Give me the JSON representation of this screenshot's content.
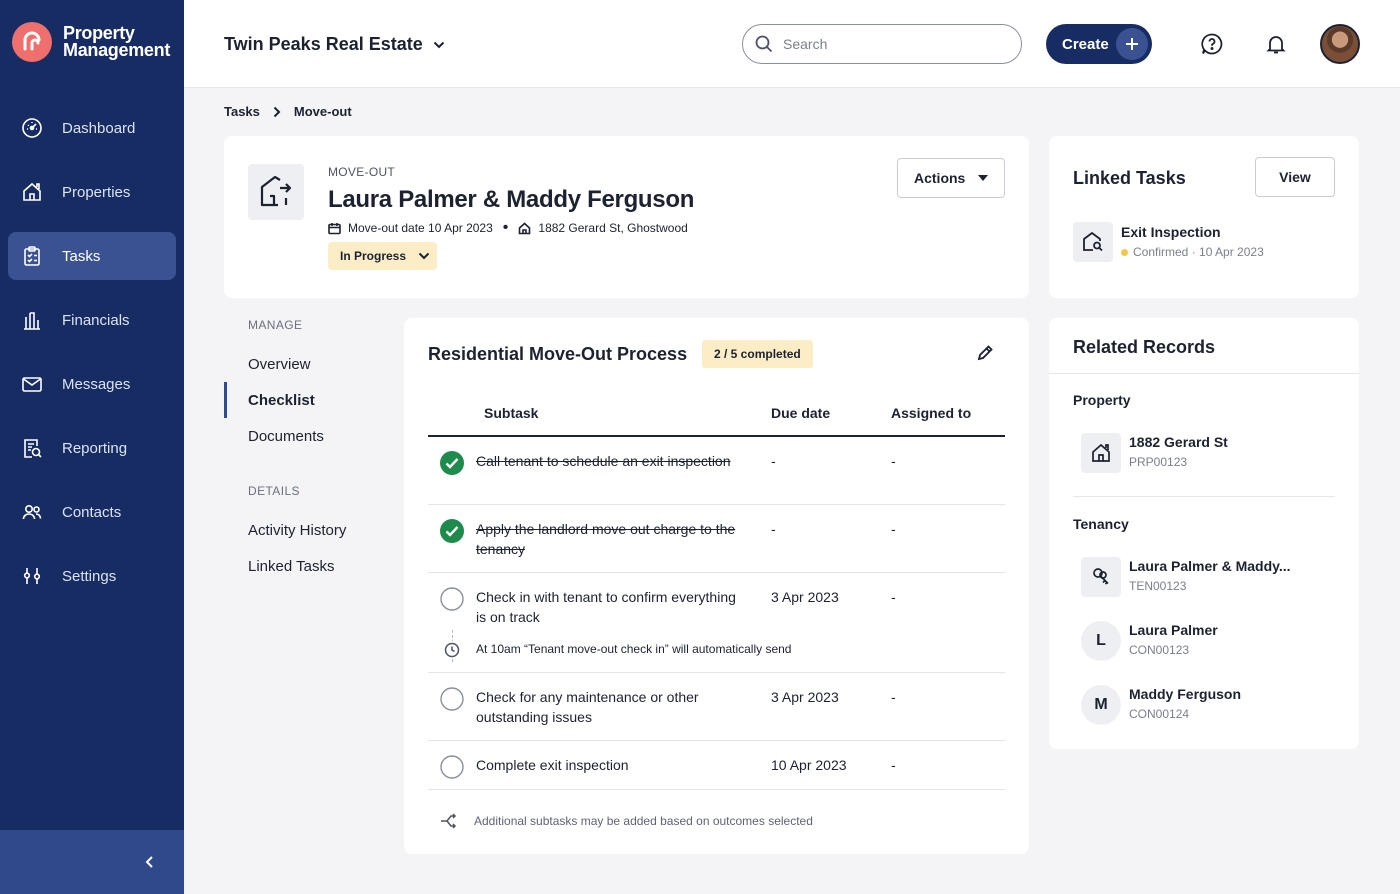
{
  "brand": {
    "line1": "Property",
    "line2": "Management"
  },
  "sidebar": {
    "items": [
      {
        "label": "Dashboard",
        "icon": "dashboard-icon",
        "active": false
      },
      {
        "label": "Properties",
        "icon": "house-icon",
        "active": false
      },
      {
        "label": "Tasks",
        "icon": "clipboard-icon",
        "active": true
      },
      {
        "label": "Financials",
        "icon": "bank-icon",
        "active": false
      },
      {
        "label": "Messages",
        "icon": "envelope-icon",
        "active": false
      },
      {
        "label": "Reporting",
        "icon": "report-icon",
        "active": false
      },
      {
        "label": "Contacts",
        "icon": "people-icon",
        "active": false
      },
      {
        "label": "Settings",
        "icon": "sliders-icon",
        "active": false
      }
    ]
  },
  "header": {
    "company": "Twin Peaks Real Estate",
    "search_placeholder": "Search",
    "create_label": "Create"
  },
  "breadcrumb": {
    "parent": "Tasks",
    "current": "Move-out"
  },
  "task": {
    "kicker": "MOVE-OUT",
    "title": "Laura Palmer & Maddy Ferguson",
    "moveout_date": "Move-out date 10 Apr 2023",
    "address": "1882 Gerard St, Ghostwood",
    "status": "In Progress",
    "actions_label": "Actions"
  },
  "manage": {
    "manage_label": "MANAGE",
    "manage_links": [
      "Overview",
      "Checklist",
      "Documents"
    ],
    "details_label": "DETAILS",
    "details_links": [
      "Activity History",
      "Linked Tasks"
    ],
    "active": "Checklist"
  },
  "checklist": {
    "title": "Residential Move-Out Process",
    "progress": "2 / 5 completed",
    "completed": 2,
    "total": 5,
    "columns": {
      "subtask": "Subtask",
      "due": "Due date",
      "assigned": "Assigned to"
    },
    "rows": [
      {
        "subtask": "Call tenant to schedule an exit inspection",
        "due": "-",
        "assigned": "-",
        "done": true
      },
      {
        "subtask": "Apply the landlord move out charge to the tenancy",
        "due": "-",
        "assigned": "-",
        "done": true
      },
      {
        "subtask": "Check in with tenant to confirm everything is on track",
        "due": "3 Apr 2023",
        "assigned": "-",
        "done": false,
        "automation": "At 10am “Tenant move-out check in” will automatically send"
      },
      {
        "subtask": "Check for any maintenance or other outstanding issues",
        "due": "3 Apr 2023",
        "assigned": "-",
        "done": false
      },
      {
        "subtask": "Complete exit inspection",
        "due": "10 Apr 2023",
        "assigned": "-",
        "done": false
      }
    ],
    "footer_note": "Additional subtasks may be added based on outcomes selected"
  },
  "linked_tasks": {
    "title": "Linked Tasks",
    "view_label": "View",
    "items": [
      {
        "name": "Exit Inspection",
        "status": "Confirmed · 10 Apr 2023",
        "status_color": "#f2c84b"
      }
    ]
  },
  "related": {
    "title": "Related Records",
    "property_label": "Property",
    "property": {
      "name": "1882 Gerard St",
      "code": "PRP00123"
    },
    "tenancy_label": "Tenancy",
    "tenancy": [
      {
        "name": "Laura Palmer & Maddy...",
        "code": "TEN00123",
        "icon": "keys-icon"
      },
      {
        "name": "Laura Palmer",
        "code": "CON00123",
        "initial": "L"
      },
      {
        "name": "Maddy Ferguson",
        "code": "CON00124",
        "initial": "M"
      }
    ]
  },
  "colors": {
    "sidebar": "#172c63",
    "sidebar_active": "#3a5291",
    "accent_success": "#1e8a4c",
    "badge_bg": "#fcedc7",
    "brand_logo": "#ef6f6c"
  }
}
